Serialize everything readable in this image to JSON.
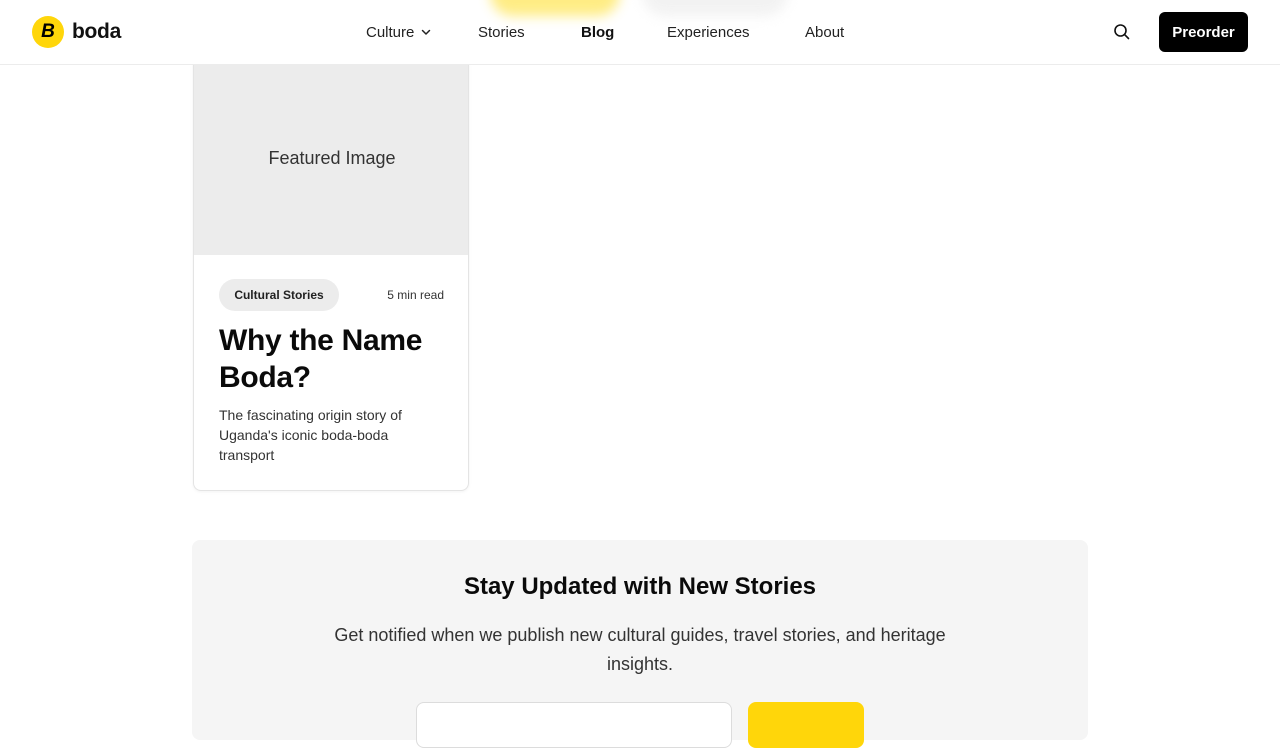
{
  "brand": {
    "logo_letter": "B",
    "name": "boda",
    "accent": "#ffd60a"
  },
  "nav": {
    "items": [
      {
        "label": "Culture",
        "has_dropdown": true
      },
      {
        "label": "Stories"
      },
      {
        "label": "Blog",
        "active": true
      },
      {
        "label": "Experiences"
      },
      {
        "label": "About"
      }
    ]
  },
  "header": {
    "search_icon": "search-icon",
    "preorder_label": "Preorder"
  },
  "post": {
    "image_placeholder": "Featured Image",
    "category": "Cultural Stories",
    "read_time": "5 min read",
    "title": "Why the Name Boda?",
    "description": "The fascinating origin story of Uganda's iconic boda-boda transport"
  },
  "newsletter": {
    "title": "Stay Updated with New Stories",
    "subtitle": "Get notified when we publish new cultural guides, travel stories, and heritage insights.",
    "email_placeholder": "",
    "submit_label": ""
  }
}
